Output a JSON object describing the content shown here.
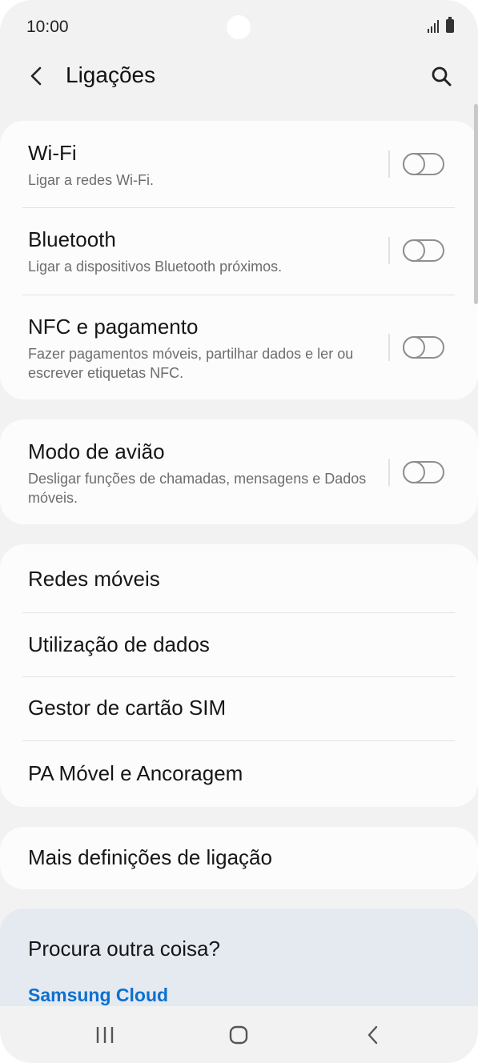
{
  "status_bar": {
    "time": "10:00"
  },
  "header": {
    "title": "Ligações"
  },
  "connections": [
    {
      "title": "Wi-Fi",
      "subtitle": "Ligar a redes Wi-Fi.",
      "on": false
    },
    {
      "title": "Bluetooth",
      "subtitle": "Ligar a dispositivos Bluetooth próximos.",
      "on": false
    },
    {
      "title": "NFC e pagamento",
      "subtitle": "Fazer pagamentos móveis, partilhar dados e ler ou escrever etiquetas NFC.",
      "on": false
    }
  ],
  "airplane": {
    "title": "Modo de avião",
    "subtitle": "Desligar funções de chamadas, mensagens e Dados móveis.",
    "on": false
  },
  "network_items": [
    {
      "label": "Redes móveis"
    },
    {
      "label": "Utilização de dados"
    },
    {
      "label": "Gestor de cartão SIM"
    },
    {
      "label": "PA Móvel e Ancoragem"
    }
  ],
  "more": {
    "label": "Mais definições de ligação"
  },
  "suggestions": {
    "title": "Procura outra coisa?",
    "link": "Samsung Cloud"
  },
  "icons": {
    "back": "chevron-left-icon",
    "search": "search-icon",
    "nav_recents": "recents-icon",
    "nav_home": "home-icon",
    "nav_back": "back-icon"
  },
  "colors": {
    "background": "#f2f2f2",
    "card": "#fcfcfc",
    "suggestion_card": "#e5e9f0",
    "link": "#0b71cf"
  }
}
